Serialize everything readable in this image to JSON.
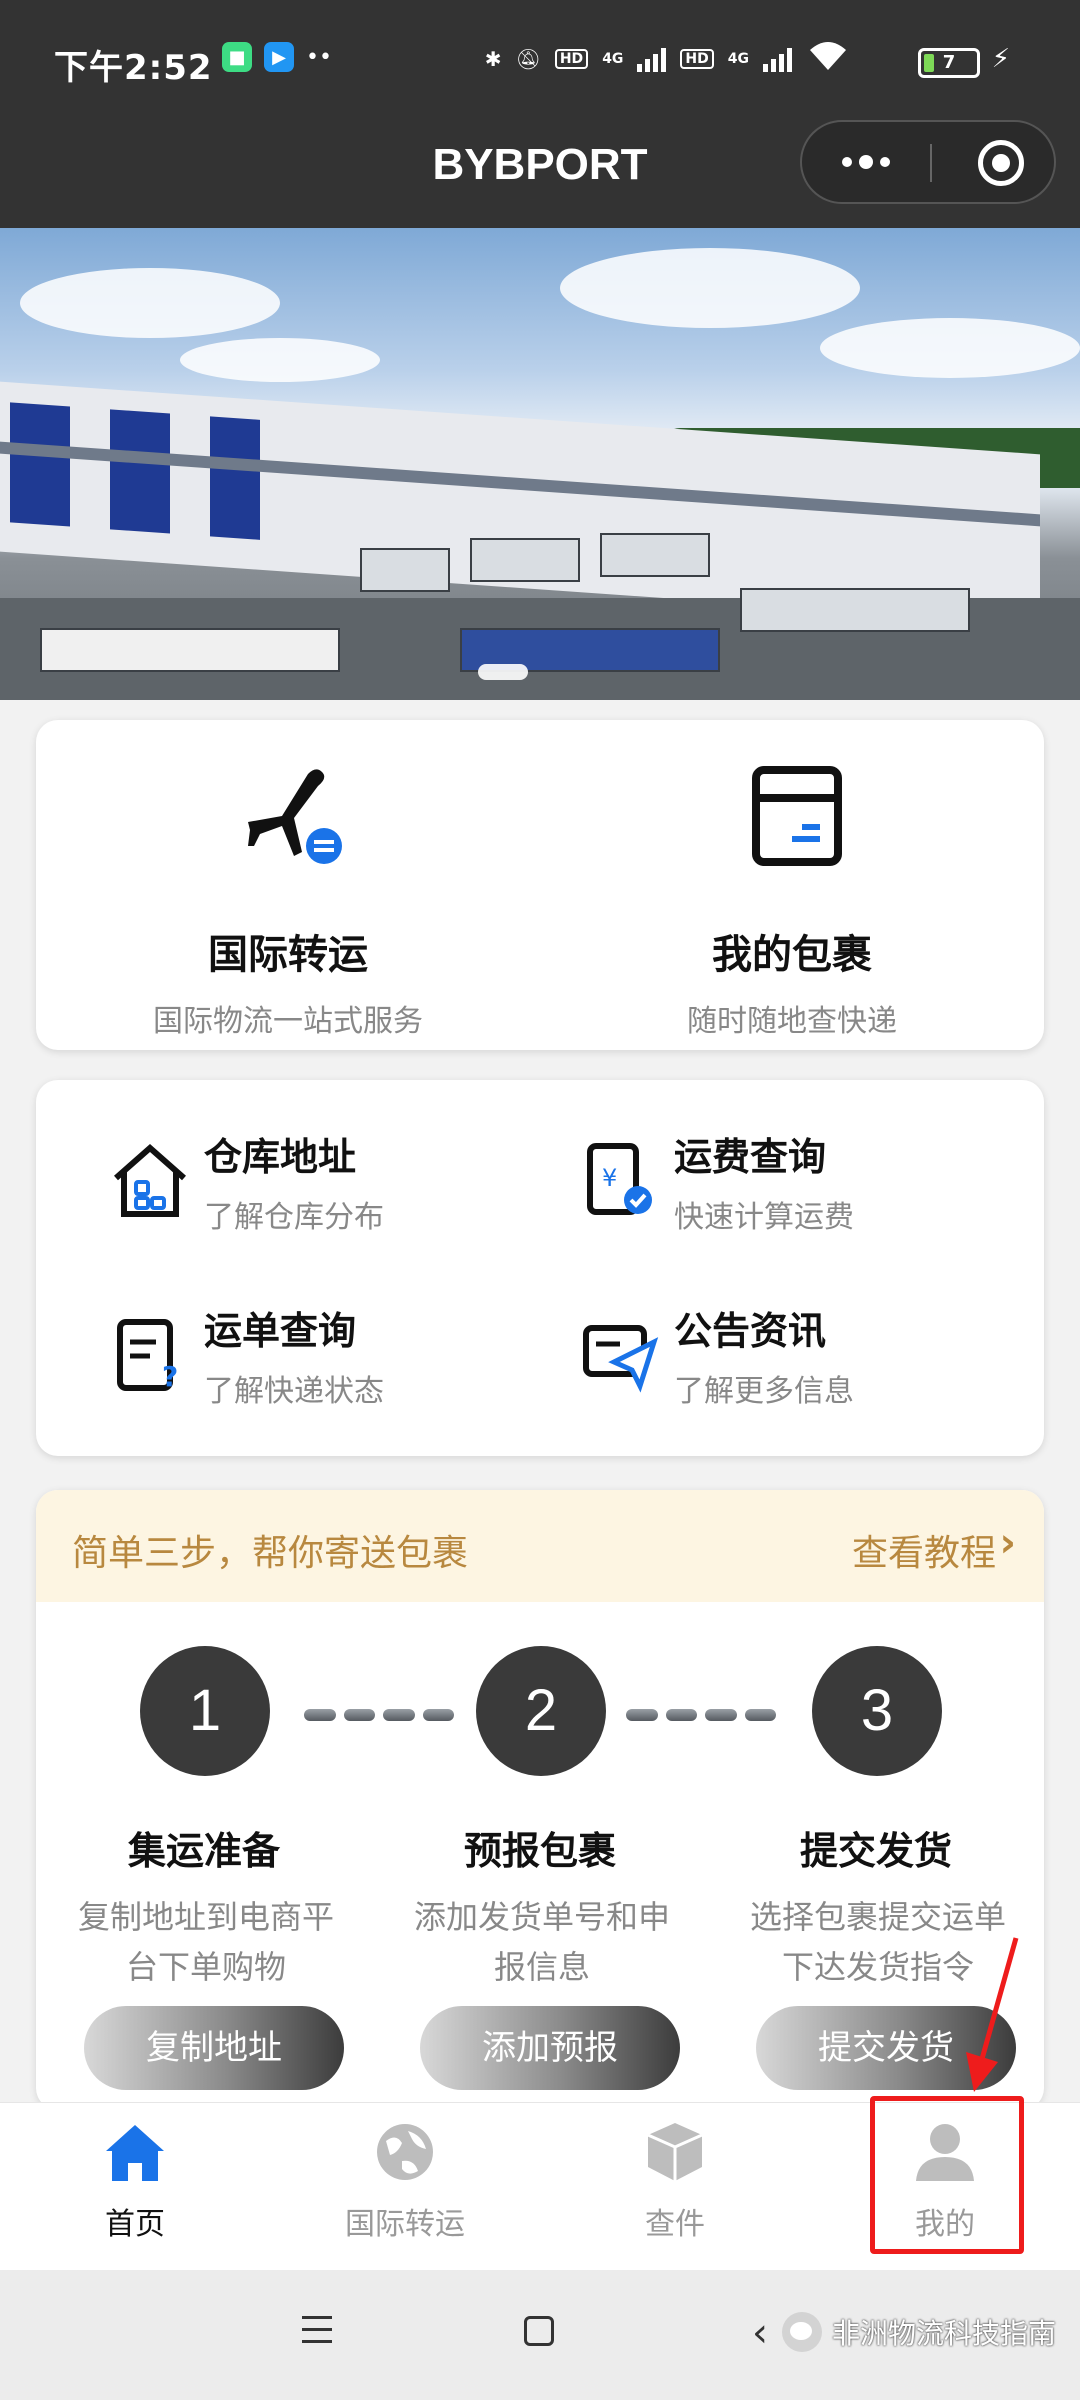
{
  "status_bar": {
    "time": "下午2:52",
    "network_1": "4G",
    "network_2": "4G",
    "hd_1": "HD",
    "hd_2": "HD",
    "battery": "7"
  },
  "title_bar": {
    "title": "BYBPORT"
  },
  "banner": {
    "active_slide": 1
  },
  "main_features": [
    {
      "title": "国际转运",
      "subtitle": "国际物流一站式服务"
    },
    {
      "title": "我的包裹",
      "subtitle": "随时随地查快递"
    }
  ],
  "quick_links": [
    {
      "title": "仓库地址",
      "subtitle": "了解仓库分布"
    },
    {
      "title": "运费查询",
      "subtitle": "快速计算运费"
    },
    {
      "title": "运单查询",
      "subtitle": "了解快递状态"
    },
    {
      "title": "公告资讯",
      "subtitle": "了解更多信息"
    }
  ],
  "steps_section": {
    "title": "简单三步，帮你寄送包裹",
    "link": "查看教程",
    "steps": [
      {
        "number": "1",
        "title": "集运准备",
        "description": "复制地址到电商平台下单购物",
        "button": "复制地址"
      },
      {
        "number": "2",
        "title": "预报包裹",
        "description": "添加发货单号和申报信息",
        "button": "添加预报"
      },
      {
        "number": "3",
        "title": "提交发货",
        "description": "选择包裹提交运单下达发货指令",
        "button": "提交发货"
      }
    ]
  },
  "tab_bar": {
    "tabs": [
      {
        "label": "首页",
        "icon": "home-icon",
        "active": true
      },
      {
        "label": "国际转运",
        "icon": "globe-icon",
        "active": false
      },
      {
        "label": "查件",
        "icon": "package-icon",
        "active": false
      },
      {
        "label": "我的",
        "icon": "user-icon",
        "active": false
      }
    ]
  },
  "watermark": {
    "text": "非洲物流科技指南"
  },
  "colors": {
    "header_bg": "#333333",
    "accent_blue": "#1a73e8",
    "steps_header_bg": "#fdf5e2",
    "steps_header_text": "#b8883f",
    "annotation_red": "#ee1c1c"
  }
}
